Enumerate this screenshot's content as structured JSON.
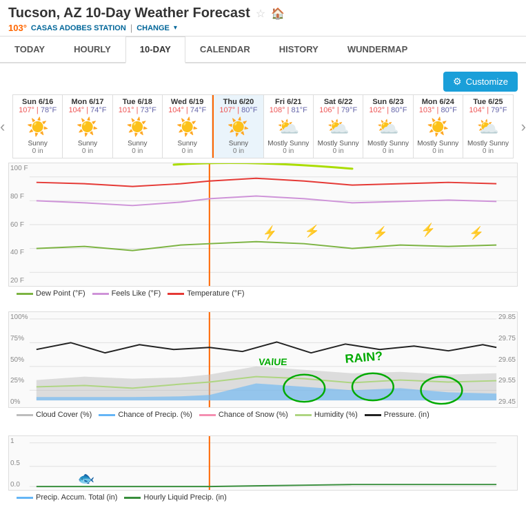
{
  "header": {
    "title": "Tucson, AZ 10-Day Weather Forecast",
    "temp": "103°",
    "station": "CASAS ADOBES STATION",
    "change_label": "CHANGE"
  },
  "nav": {
    "tabs": [
      {
        "label": "TODAY",
        "active": false
      },
      {
        "label": "HOURLY",
        "active": false
      },
      {
        "label": "10-DAY",
        "active": true
      },
      {
        "label": "CALENDAR",
        "active": false
      },
      {
        "label": "HISTORY",
        "active": false
      },
      {
        "label": "WUNDERMAP",
        "active": false
      }
    ]
  },
  "toolbar": {
    "customize_label": "Customize"
  },
  "forecast": {
    "days": [
      {
        "day": "Sun 6/16",
        "high": "107°",
        "low": "78°F",
        "icon": "☀️",
        "desc": "Sunny",
        "precip": "0 in",
        "active": false
      },
      {
        "day": "Mon 6/17",
        "high": "104°",
        "low": "74°F",
        "icon": "☀️",
        "desc": "Sunny",
        "precip": "0 in",
        "active": false
      },
      {
        "day": "Tue 6/18",
        "high": "101°",
        "low": "73°F",
        "icon": "☀️",
        "desc": "Sunny",
        "precip": "0 in",
        "active": false
      },
      {
        "day": "Wed 6/19",
        "high": "104°",
        "low": "74°F",
        "icon": "☀️",
        "desc": "Sunny",
        "precip": "0 in",
        "active": false
      },
      {
        "day": "Thu 6/20",
        "high": "107°",
        "low": "80°F",
        "icon": "☀️",
        "desc": "Sunny",
        "precip": "0 in",
        "active": true
      },
      {
        "day": "Fri 6/21",
        "high": "108°",
        "low": "81°F",
        "icon": "⛅",
        "desc": "Mostly Sunny",
        "precip": "0 in",
        "active": false
      },
      {
        "day": "Sat 6/22",
        "high": "106°",
        "low": "79°F",
        "icon": "⛅",
        "desc": "Mostly Sunny",
        "precip": "0 in",
        "active": false
      },
      {
        "day": "Sun 6/23",
        "high": "102°",
        "low": "80°F",
        "icon": "⛅",
        "desc": "Mostly Sunny",
        "precip": "0 in",
        "active": false
      },
      {
        "day": "Mon 6/24",
        "high": "103°",
        "low": "80°F",
        "icon": "☀️",
        "desc": "Mostly Sunny",
        "precip": "0 in",
        "active": false
      },
      {
        "day": "Tue 6/25",
        "high": "104°",
        "low": "79°F",
        "icon": "⛅",
        "desc": "Mostly Sunny",
        "precip": "0 in",
        "active": false
      }
    ]
  },
  "chart1": {
    "y_labels": [
      "100 F",
      "80 F",
      "60 F",
      "40 F",
      "20 F"
    ],
    "legend": [
      {
        "label": "Dew Point (°F)",
        "color": "#7cb342"
      },
      {
        "label": "Feels Like (°F)",
        "color": "#ce93d8"
      },
      {
        "label": "Temperature (°F)",
        "color": "#e53935"
      }
    ]
  },
  "chart2": {
    "y_labels_left": [
      "100%",
      "75%",
      "50%",
      "25%",
      "0%"
    ],
    "y_labels_right": [
      "29.85",
      "29.75",
      "29.65",
      "29.55",
      "29.45"
    ],
    "legend": [
      {
        "label": "Cloud Cover (%)",
        "color": "#bdbdbd"
      },
      {
        "label": "Chance of Precip. (%)",
        "color": "#64b5f6"
      },
      {
        "label": "Chance of Snow (%)",
        "color": "#f48fb1"
      },
      {
        "label": "Humidity (%)",
        "color": "#aed581"
      },
      {
        "label": "Pressure. (in)",
        "color": "#212121"
      }
    ]
  },
  "chart3": {
    "y_labels": [
      "1",
      "0.5",
      "0.0"
    ],
    "legend": [
      {
        "label": "Precip. Accum. Total (in)",
        "color": "#64b5f6"
      },
      {
        "label": "Hourly Liquid Precip. (in)",
        "color": "#388e3c"
      }
    ]
  }
}
